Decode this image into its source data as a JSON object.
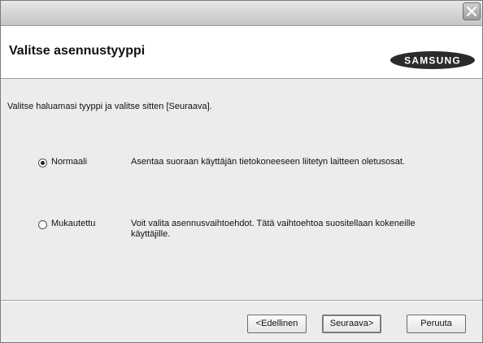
{
  "window": {
    "title": "",
    "close_icon": "close-icon"
  },
  "header": {
    "title": "Valitse asennustyyppi",
    "logo_text": "SAMSUNG"
  },
  "content": {
    "instruction": "Valitse haluamasi tyyppi ja valitse sitten [Seuraava].",
    "options": [
      {
        "label": "Normaali",
        "selected": true,
        "description_lines": [
          "Asentaa suoraan käyttäjän tietokoneeseen liitetyn laitteen oletusosat."
        ]
      },
      {
        "label": "Mukautettu",
        "selected": false,
        "description_lines": [
          "Voit valita asennusvaihtoehdot. Tätä vaihtoehtoa suositellaan kokeneille",
          "käyttäjille."
        ]
      }
    ]
  },
  "footer": {
    "back_label": "<Edellinen",
    "next_label": "Seuraava>",
    "cancel_label": "Peruuta"
  }
}
